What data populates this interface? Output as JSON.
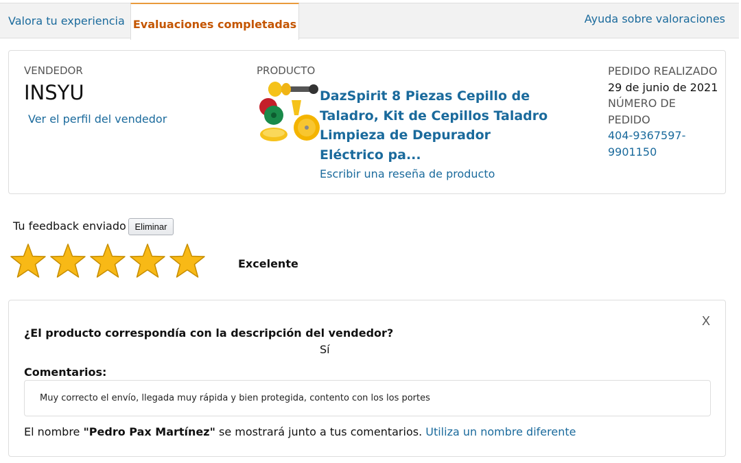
{
  "tabs": {
    "rate": "Valora tu experiencia",
    "completed": "Evaluaciones completadas",
    "help": "Ayuda sobre valoraciones"
  },
  "seller": {
    "label": "VENDEDOR",
    "name": "INSYU",
    "profile_link": "Ver el perfil del vendedor"
  },
  "product": {
    "label": "PRODUCTO",
    "title": "DazSpirit 8 Piezas Cepillo de Taladro, Kit de Cepillos Taladro Limpieza de Depurador Eléctrico pa...",
    "review_link": "Escribir una reseña de producto"
  },
  "order": {
    "placed_label": "PEDIDO REALIZADO",
    "placed_date": "29 de junio de 2021",
    "number_label": "NÚMERO DE PEDIDO",
    "number": "404-9367597-9901150"
  },
  "feedback": {
    "label": "Tu feedback enviado",
    "delete_button": "Eliminar",
    "stars": 5,
    "stars_max": 5,
    "rating_text": "Excelente",
    "star_color": "#f8b916"
  },
  "details": {
    "close": "X",
    "question": "¿El producto correspondía con la descripción del vendedor?",
    "answer": "Sí",
    "comments_label": "Comentarios:",
    "comment": "Muy correcto el envío, llegada muy rápida y bien protegida, contento con los los portes",
    "name_prefix": "El nombre ",
    "name": "\"Pedro Pax Martínez\"",
    "name_suffix": " se mostrará junto a tus comentarios. ",
    "change_name_link": "Utiliza un nombre diferente"
  }
}
